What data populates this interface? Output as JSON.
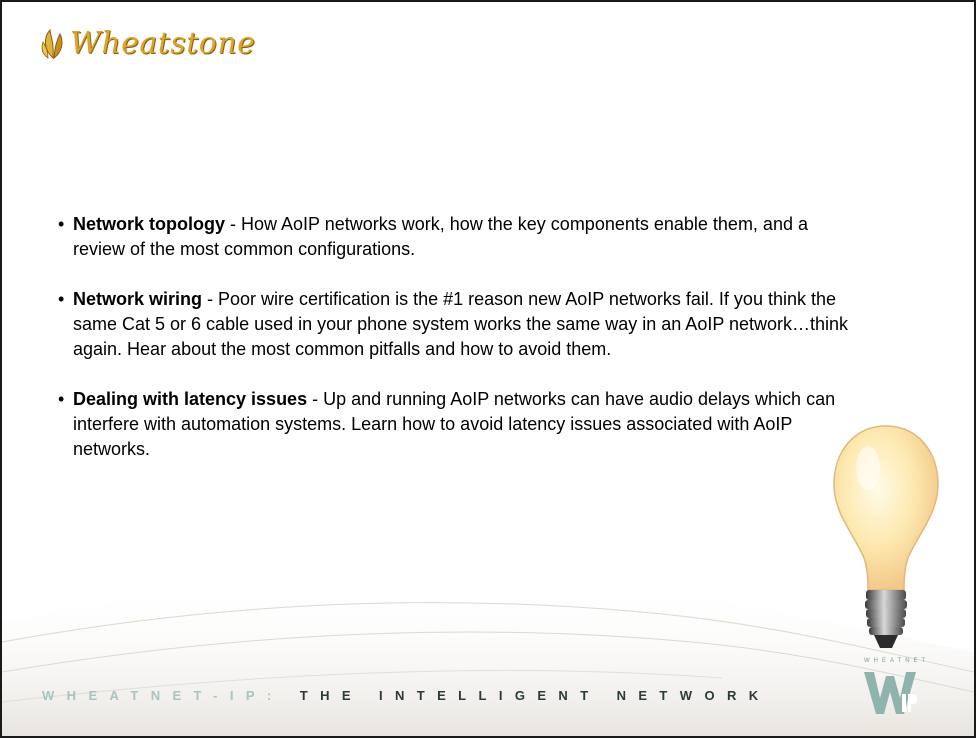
{
  "logo": {
    "text": "Wheatstone",
    "icon": "wheat-leaf-icon"
  },
  "bullets": [
    {
      "marker": "•",
      "title": "Network topology",
      "body": " - How AoIP networks work, how the key components enable them, and a review of the most common configurations."
    },
    {
      "marker": "•",
      "title": "Network wiring",
      "body": " - Poor wire certification is the #1 reason new AoIP networks fail. If you think the same Cat 5 or 6 cable used in your phone system works the same way in an AoIP network…think again. Hear about the most common pitfalls and how to avoid them."
    },
    {
      "marker": "•",
      "title": "Dealing with latency issues",
      "body": " - Up and running AoIP networks can have audio delays which can interfere with automation systems. Learn how to avoid latency issues associated with AoIP networks."
    }
  ],
  "footer": {
    "tagline_brand": "WHEATNET-IP:",
    "tagline_rest": "THE INTELLIGENT NETWORK",
    "wheatnet_small": "WHEATNET",
    "wheatnet_logo_letters": "W IP"
  },
  "colors": {
    "logo_gold": "#d9a62b",
    "tagline_teal": "#a7c4c0",
    "tagline_dark": "#2e3a3a",
    "bulb_glow": "#fde9b0"
  },
  "icons": {
    "bulb": "light-bulb-icon",
    "wheatnet": "wheatnet-logo-icon"
  }
}
